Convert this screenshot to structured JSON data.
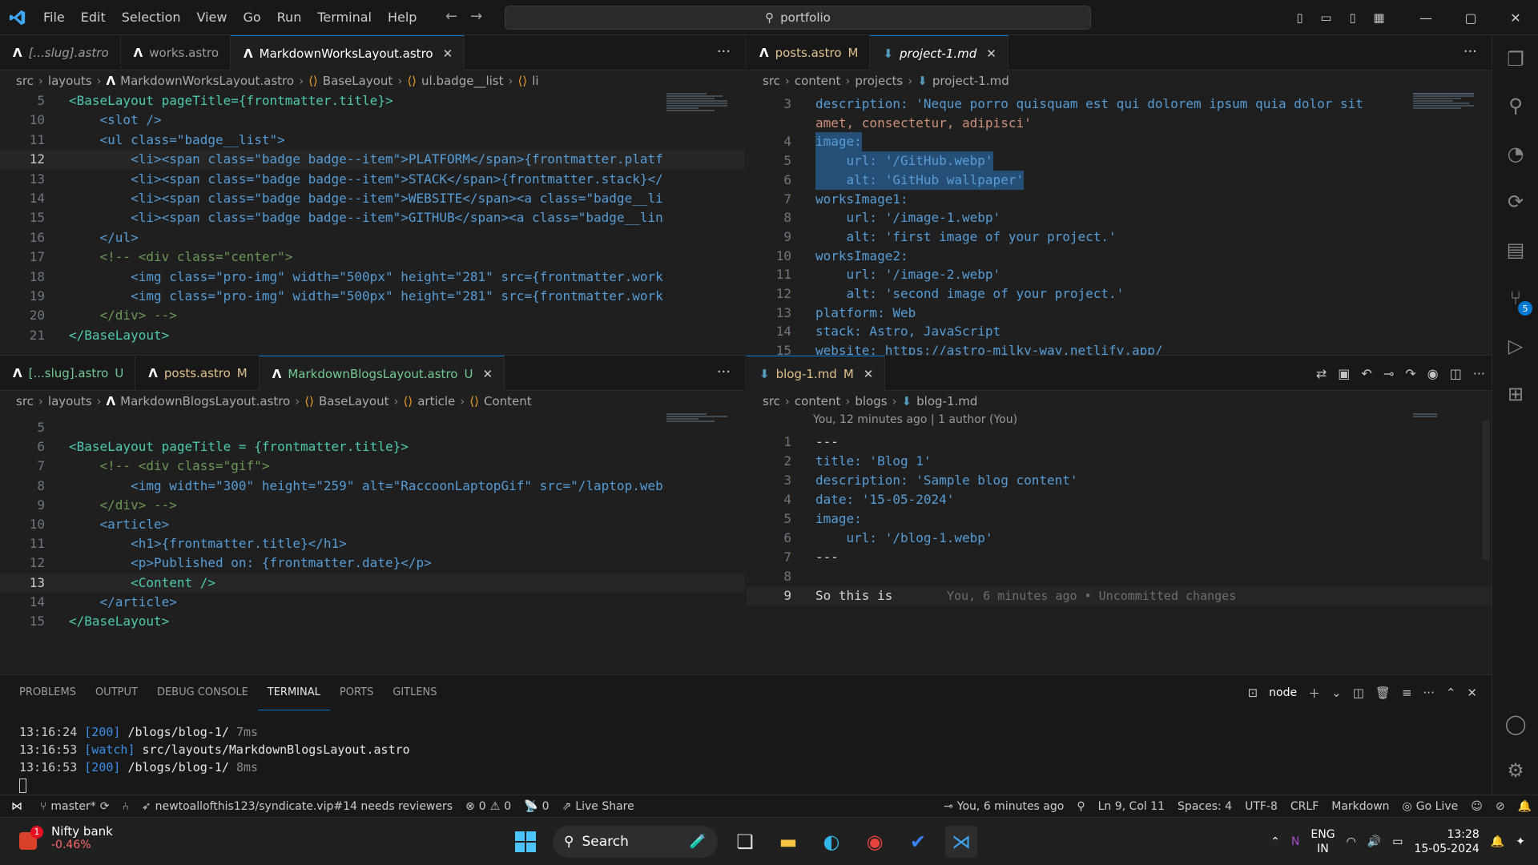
{
  "titlebar": {
    "menu": [
      "File",
      "Edit",
      "Selection",
      "View",
      "Go",
      "Run",
      "Terminal",
      "Help"
    ],
    "command_center": "portfolio"
  },
  "group1": {
    "tabs": [
      {
        "label": "[...slug].astro",
        "italic": true
      },
      {
        "label": "works.astro"
      },
      {
        "label": "MarkdownWorksLayout.astro",
        "active": true
      }
    ],
    "breadcrumb": [
      "src",
      "layouts",
      "MarkdownWorksLayout.astro",
      "BaseLayout",
      "ul.badge__list",
      "li"
    ],
    "lines": [
      {
        "n": "5",
        "code": "<BaseLayout pageTitle={frontmatter.title}>"
      },
      {
        "n": "10",
        "code": "    <slot />"
      },
      {
        "n": "11",
        "code": "    <ul class=\"badge__list\">"
      },
      {
        "n": "12",
        "code": "        <li><span class=\"badge badge--item\">PLATFORM</span>{frontmatter.platf"
      },
      {
        "n": "13",
        "code": "        <li><span class=\"badge badge--item\">STACK</span>{frontmatter.stack}</"
      },
      {
        "n": "14",
        "code": "        <li><span class=\"badge badge--item\">WEBSITE</span><a class=\"badge__li"
      },
      {
        "n": "15",
        "code": "        <li><span class=\"badge badge--item\">GITHUB</span><a class=\"badge__lin"
      },
      {
        "n": "16",
        "code": "    </ul>"
      },
      {
        "n": "17",
        "code": "    <!-- <div class=\"center\">"
      },
      {
        "n": "18",
        "code": "        <img class=\"pro-img\" width=\"500px\" height=\"281\" src={frontmatter.work"
      },
      {
        "n": "19",
        "code": "        <img class=\"pro-img\" width=\"500px\" height=\"281\" src={frontmatter.work"
      },
      {
        "n": "20",
        "code": "    </div> -->"
      },
      {
        "n": "21",
        "code": "</BaseLayout>"
      }
    ]
  },
  "group2": {
    "tabs": [
      {
        "label": "posts.astro",
        "status": "M"
      },
      {
        "label": "project-1.md",
        "active": true,
        "italic": true
      }
    ],
    "breadcrumb": [
      "src",
      "content",
      "projects",
      "project-1.md"
    ],
    "lines": [
      {
        "n": "3",
        "code": "description: 'Neque porro quisquam est qui dolorem ipsum quia dolor sit"
      },
      {
        "n": "",
        "code": "amet, consectetur, adipisci'"
      },
      {
        "n": "4",
        "code": "image:"
      },
      {
        "n": "5",
        "code": "    url: '/GitHub.webp'"
      },
      {
        "n": "6",
        "code": "    alt: 'GitHub wallpaper'"
      },
      {
        "n": "7",
        "code": "worksImage1:"
      },
      {
        "n": "8",
        "code": "    url: '/image-1.webp'"
      },
      {
        "n": "9",
        "code": "    alt: 'first image of your project.'"
      },
      {
        "n": "10",
        "code": "worksImage2:"
      },
      {
        "n": "11",
        "code": "    url: '/image-2.webp'"
      },
      {
        "n": "12",
        "code": "    alt: 'second image of your project.'"
      },
      {
        "n": "13",
        "code": "platform: Web"
      },
      {
        "n": "14",
        "code": "stack: Astro, JavaScript"
      },
      {
        "n": "15",
        "code": "website: https://astro-milky-way.netlify.app/"
      }
    ]
  },
  "group3": {
    "tabs": [
      {
        "label": "[...slug].astro",
        "status": "U"
      },
      {
        "label": "posts.astro",
        "status": "M"
      },
      {
        "label": "MarkdownBlogsLayout.astro",
        "status": "U",
        "active": true
      }
    ],
    "breadcrumb": [
      "src",
      "layouts",
      "MarkdownBlogsLayout.astro",
      "BaseLayout",
      "article",
      "Content"
    ],
    "lines": [
      {
        "n": "5",
        "code": ""
      },
      {
        "n": "6",
        "code": "<BaseLayout pageTitle = {frontmatter.title}>"
      },
      {
        "n": "7",
        "code": "    <!-- <div class=\"gif\">"
      },
      {
        "n": "8",
        "code": "        <img width=\"300\" height=\"259\" alt=\"RaccoonLaptopGif\" src=\"/laptop.web"
      },
      {
        "n": "9",
        "code": "    </div> -->"
      },
      {
        "n": "10",
        "code": "    <article>"
      },
      {
        "n": "11",
        "code": "        <h1>{frontmatter.title}</h1>"
      },
      {
        "n": "12",
        "code": "        <p>Published on: {frontmatter.date}</p>"
      },
      {
        "n": "13",
        "code": "        <Content />"
      },
      {
        "n": "14",
        "code": "    </article>"
      },
      {
        "n": "15",
        "code": "</BaseLayout>"
      }
    ]
  },
  "group4": {
    "tabs": [
      {
        "label": "blog-1.md",
        "status": "M",
        "active": true
      }
    ],
    "breadcrumb": [
      "src",
      "content",
      "blogs",
      "blog-1.md"
    ],
    "codelens": "You, 12 minutes ago | 1 author (You)",
    "lines": [
      {
        "n": "1",
        "code": "---"
      },
      {
        "n": "2",
        "code": "title: 'Blog 1'"
      },
      {
        "n": "3",
        "code": "description: 'Sample blog content'"
      },
      {
        "n": "4",
        "code": "date: '15-05-2024'"
      },
      {
        "n": "5",
        "code": "image:"
      },
      {
        "n": "6",
        "code": "    url: '/blog-1.webp'"
      },
      {
        "n": "7",
        "code": "---"
      },
      {
        "n": "8",
        "code": ""
      },
      {
        "n": "9",
        "code": "So this is"
      }
    ],
    "blame": "You, 6 minutes ago • Uncommitted changes"
  },
  "panel": {
    "tabs": [
      "PROBLEMS",
      "OUTPUT",
      "DEBUG CONSOLE",
      "TERMINAL",
      "PORTS",
      "GITLENS"
    ],
    "active_tab": "TERMINAL",
    "terminal_name": "node",
    "terminal_lines": [
      {
        "time": "13:16:24",
        "tag": "[200]",
        "msg": "/blogs/blog-1/",
        "extra": "7ms"
      },
      {
        "time": "13:16:53",
        "tag": "[watch]",
        "msg": "src/layouts/MarkdownBlogsLayout.astro",
        "extra": ""
      },
      {
        "time": "13:16:53",
        "tag": "[200]",
        "msg": "/blogs/blog-1/",
        "extra": "8ms"
      }
    ]
  },
  "activitybar": {
    "scm_badge": "5"
  },
  "statusbar": {
    "branch": "master*",
    "pr": "newtoallofthis123/syndicate.vip#14 needs reviewers",
    "errors": "0",
    "warnings": "0",
    "ports": "0",
    "live_share": "Live Share",
    "blame": "You, 6 minutes ago",
    "position": "Ln 9, Col 11",
    "spaces": "Spaces: 4",
    "encoding": "UTF-8",
    "eol": "CRLF",
    "language": "Markdown",
    "go_live": "Go Live"
  },
  "taskbar": {
    "widget_title": "Nifty bank",
    "widget_value": "-0.46%",
    "widget_badge": "1",
    "search": "Search",
    "lang_top": "ENG",
    "lang_bottom": "IN",
    "time": "13:28",
    "date": "15-05-2024"
  },
  "colors": {
    "accent": "#0078d4",
    "modified": "#e2c08d",
    "untracked": "#73c991"
  }
}
